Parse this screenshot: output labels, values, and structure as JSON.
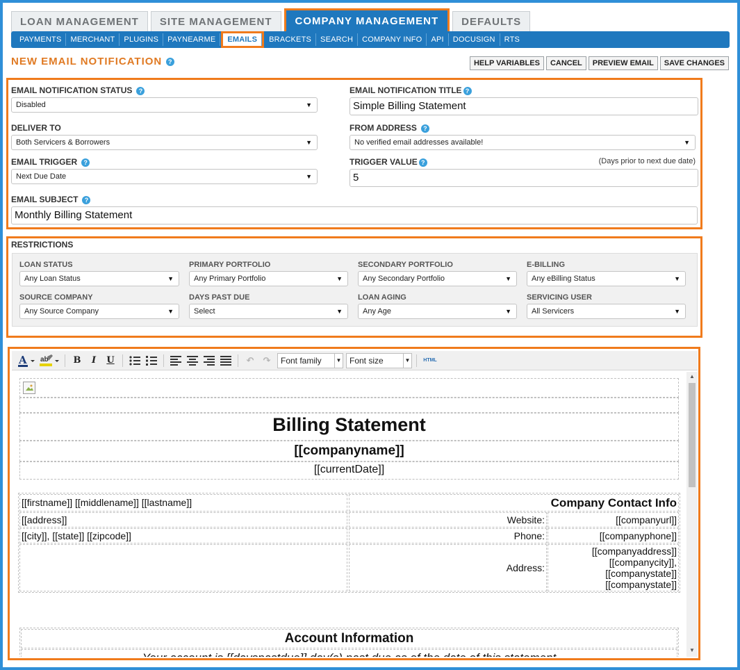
{
  "main_tabs": [
    "LOAN MANAGEMENT",
    "SITE MANAGEMENT",
    "COMPANY MANAGEMENT",
    "DEFAULTS"
  ],
  "active_main_tab": "COMPANY MANAGEMENT",
  "sub_nav": [
    "PAYMENTS",
    "MERCHANT",
    "PLUGINS",
    "PAYNEARME",
    "EMAILS",
    "BRACKETS",
    "SEARCH",
    "COMPANY INFO",
    "API",
    "DOCUSIGN",
    "RTS"
  ],
  "active_sub_nav": "EMAILS",
  "page_title": "NEW EMAIL NOTIFICATION",
  "actions": {
    "help_variables": "HELP VARIABLES",
    "cancel": "CANCEL",
    "preview_email": "PREVIEW EMAIL",
    "save_changes": "SAVE CHANGES"
  },
  "form": {
    "status_label": "EMAIL NOTIFICATION STATUS",
    "status_value": "Disabled",
    "title_label": "EMAIL NOTIFICATION TITLE",
    "title_value": "Simple Billing Statement",
    "deliver_label": "DELIVER TO",
    "deliver_value": "Both Servicers & Borrowers",
    "from_label": "FROM ADDRESS",
    "from_value": "No verified email addresses available!",
    "trigger_label": "EMAIL TRIGGER",
    "trigger_value": "Next Due Date",
    "trigger_value_label": "TRIGGER VALUE",
    "trigger_value_note": "(Days prior to next due date)",
    "trigger_value_value": "5",
    "subject_label": "EMAIL SUBJECT",
    "subject_value": "Monthly Billing Statement"
  },
  "restrictions": {
    "title": "RESTRICTIONS",
    "loan_status_label": "LOAN STATUS",
    "loan_status_value": "Any Loan Status",
    "primary_portfolio_label": "PRIMARY PORTFOLIO",
    "primary_portfolio_value": "Any Primary Portfolio",
    "secondary_portfolio_label": "SECONDARY PORTFOLIO",
    "secondary_portfolio_value": "Any Secondary Portfolio",
    "ebilling_label": "E-BILLING",
    "ebilling_value": "Any eBilling Status",
    "source_company_label": "SOURCE COMPANY",
    "source_company_value": "Any Source Company",
    "days_past_due_label": "DAYS PAST DUE",
    "days_past_due_value": "Select",
    "loan_aging_label": "LOAN AGING",
    "loan_aging_value": "Any Age",
    "servicing_user_label": "SERVICING USER",
    "servicing_user_value": "All Servicers"
  },
  "toolbar": {
    "font_family": "Font family",
    "font_size": "Font size",
    "html_label": "HTML"
  },
  "editor": {
    "heading": "Billing Statement",
    "company_name": "[[companyname]]",
    "current_date": "[[currentDate]]",
    "name_line": "[[firstname]] [[middlename]] [[lastname]]",
    "address_line": "[[address]]",
    "city_line": "[[city]], [[state]] [[zipcode]]",
    "contact_heading": "Company Contact Info",
    "website_label": "Website:",
    "website_value": "[[companyurl]]",
    "phone_label": "Phone:",
    "phone_value": "[[companyphone]]",
    "address_label": "Address:",
    "address_values": [
      "[[companyaddress]]",
      "[[companycity]],",
      "[[companystate]]",
      "[[companystate]]"
    ],
    "account_heading": "Account Information",
    "account_line": "Your account is [[dayspastdue]] day(s) past due as of the date of this statement"
  }
}
